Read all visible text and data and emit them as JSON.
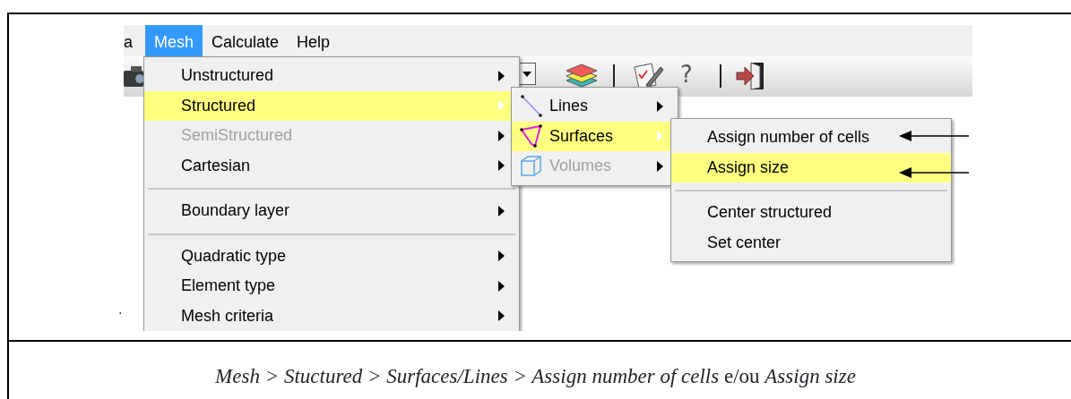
{
  "menubar": {
    "items": [
      {
        "label": "a",
        "selected": false
      },
      {
        "label": "Mesh",
        "selected": true
      },
      {
        "label": "Calculate",
        "selected": false
      },
      {
        "label": "Help",
        "selected": false
      }
    ]
  },
  "toolbar": {
    "help_glyph": "?"
  },
  "mesh_menu": {
    "items": [
      {
        "kind": "item",
        "label": "Unstructured",
        "selected": false,
        "disabled": false,
        "submenu": true
      },
      {
        "kind": "item",
        "label": "Structured",
        "selected": true,
        "disabled": false,
        "submenu": true
      },
      {
        "kind": "item",
        "label": "SemiStructured",
        "selected": false,
        "disabled": true,
        "submenu": true
      },
      {
        "kind": "item",
        "label": "Cartesian",
        "selected": false,
        "disabled": false,
        "submenu": true
      },
      {
        "kind": "separator"
      },
      {
        "kind": "item",
        "label": "Boundary layer",
        "selected": false,
        "disabled": false,
        "submenu": true
      },
      {
        "kind": "separator"
      },
      {
        "kind": "item",
        "label": "Quadratic type",
        "selected": false,
        "disabled": false,
        "submenu": true
      },
      {
        "kind": "item",
        "label": "Element type",
        "selected": false,
        "disabled": false,
        "submenu": true
      },
      {
        "kind": "item",
        "label": "Mesh criteria",
        "selected": false,
        "disabled": false,
        "submenu": true
      }
    ]
  },
  "structured_menu": {
    "items": [
      {
        "kind": "item",
        "label": "Lines",
        "selected": false,
        "disabled": false,
        "submenu": true
      },
      {
        "kind": "item",
        "label": "Surfaces",
        "selected": true,
        "disabled": false,
        "submenu": true
      },
      {
        "kind": "item",
        "label": "Volumes",
        "selected": false,
        "disabled": true,
        "submenu": true
      }
    ]
  },
  "surfaces_menu": {
    "items": [
      {
        "kind": "item",
        "label": "Assign number of cells",
        "selected": false,
        "disabled": false,
        "submenu": false
      },
      {
        "kind": "item",
        "label": "Assign size",
        "selected": true,
        "disabled": false,
        "submenu": false
      },
      {
        "kind": "separator"
      },
      {
        "kind": "item",
        "label": "Center structured",
        "selected": false,
        "disabled": false,
        "submenu": false
      },
      {
        "kind": "item",
        "label": "Set center",
        "selected": false,
        "disabled": false,
        "submenu": false
      }
    ]
  },
  "stray_mark": ".",
  "caption": "*Mesh > Stuctured > Surfaces/Lines > Assign number of cells* e/ou *Assign size*"
}
